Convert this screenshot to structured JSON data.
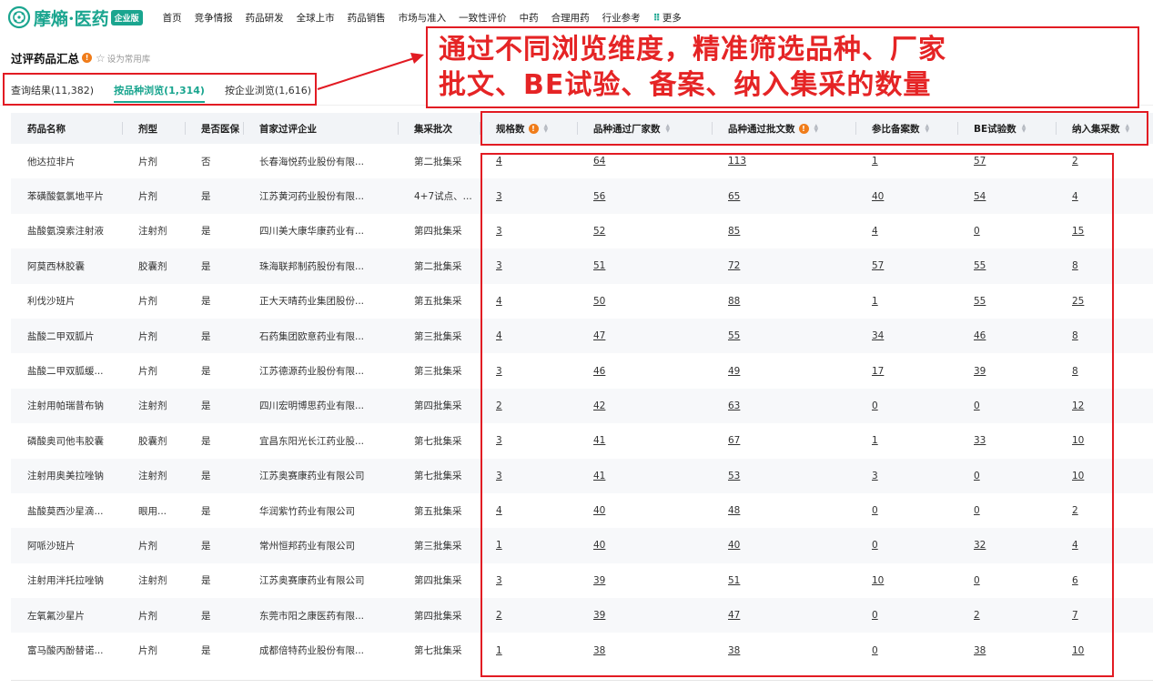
{
  "brand": {
    "name": "摩熵·医药",
    "edition_badge": "企业版",
    "color": "#1aa58f"
  },
  "nav": {
    "items": [
      "首页",
      "竞争情报",
      "药品研发",
      "全球上市",
      "药品销售",
      "市场与准入",
      "一致性评价",
      "中药",
      "合理用药",
      "行业参考"
    ],
    "more_label": "更多"
  },
  "page": {
    "title": "过评药品汇总",
    "favorite_label": "设为常用库"
  },
  "tabs": [
    {
      "label": "查询结果(11,382)",
      "active": false
    },
    {
      "label": "按品种浏览(1,314)",
      "active": true
    },
    {
      "label": "按企业浏览(1,616)",
      "active": false
    }
  ],
  "annotation": {
    "line1": "通过不同浏览维度，精准筛选品种、厂家",
    "line2": "批文、BE试验、备案、纳入集采的数量",
    "color": "#e21b23"
  },
  "table": {
    "headers": [
      "药品名称",
      "剂型",
      "是否医保",
      "首家过评企业",
      "集采批次",
      "规格数",
      "品种通过厂家数",
      "品种通过批文数",
      "参比备案数",
      "BE试验数",
      "纳入集采数"
    ],
    "rows": [
      [
        "他达拉非片",
        "片剂",
        "否",
        "长春海悦药业股份有限...",
        "第二批集采",
        "4",
        "64",
        "113",
        "1",
        "57",
        "2"
      ],
      [
        "苯磺酸氨氯地平片",
        "片剂",
        "是",
        "江苏黄河药业股份有限...",
        "4+7试点、...",
        "3",
        "56",
        "65",
        "40",
        "54",
        "4"
      ],
      [
        "盐酸氨溴索注射液",
        "注射剂",
        "是",
        "四川美大康华康药业有...",
        "第四批集采",
        "3",
        "52",
        "85",
        "4",
        "0",
        "15"
      ],
      [
        "阿莫西林胶囊",
        "胶囊剂",
        "是",
        "珠海联邦制药股份有限...",
        "第二批集采",
        "3",
        "51",
        "72",
        "57",
        "55",
        "8"
      ],
      [
        "利伐沙班片",
        "片剂",
        "是",
        "正大天晴药业集团股份...",
        "第五批集采",
        "4",
        "50",
        "88",
        "1",
        "55",
        "25"
      ],
      [
        "盐酸二甲双胍片",
        "片剂",
        "是",
        "石药集团欧意药业有限...",
        "第三批集采",
        "4",
        "47",
        "55",
        "34",
        "46",
        "8"
      ],
      [
        "盐酸二甲双胍缓...",
        "片剂",
        "是",
        "江苏德源药业股份有限...",
        "第三批集采",
        "3",
        "46",
        "49",
        "17",
        "39",
        "8"
      ],
      [
        "注射用帕瑞昔布钠",
        "注射剂",
        "是",
        "四川宏明博思药业有限...",
        "第四批集采",
        "2",
        "42",
        "63",
        "0",
        "0",
        "12"
      ],
      [
        "磷酸奥司他韦胶囊",
        "胶囊剂",
        "是",
        "宜昌东阳光长江药业股...",
        "第七批集采",
        "3",
        "41",
        "67",
        "1",
        "33",
        "10"
      ],
      [
        "注射用奥美拉唑钠",
        "注射剂",
        "是",
        "江苏奥赛康药业有限公司",
        "第七批集采",
        "3",
        "41",
        "53",
        "3",
        "0",
        "10"
      ],
      [
        "盐酸莫西沙星滴...",
        "眼用...",
        "是",
        "华润紫竹药业有限公司",
        "第五批集采",
        "4",
        "40",
        "48",
        "0",
        "0",
        "2"
      ],
      [
        "阿哌沙班片",
        "片剂",
        "是",
        "常州恒邦药业有限公司",
        "第三批集采",
        "1",
        "40",
        "40",
        "0",
        "32",
        "4"
      ],
      [
        "注射用泮托拉唑钠",
        "注射剂",
        "是",
        "江苏奥赛康药业有限公司",
        "第四批集采",
        "3",
        "39",
        "51",
        "10",
        "0",
        "6"
      ],
      [
        "左氧氟沙星片",
        "片剂",
        "是",
        "东莞市阳之康医药有限...",
        "第四批集采",
        "2",
        "39",
        "47",
        "0",
        "2",
        "7"
      ],
      [
        "富马酸丙酚替诺...",
        "片剂",
        "是",
        "成都倍特药业股份有限...",
        "第七批集采",
        "1",
        "38",
        "38",
        "0",
        "38",
        "10"
      ]
    ]
  }
}
